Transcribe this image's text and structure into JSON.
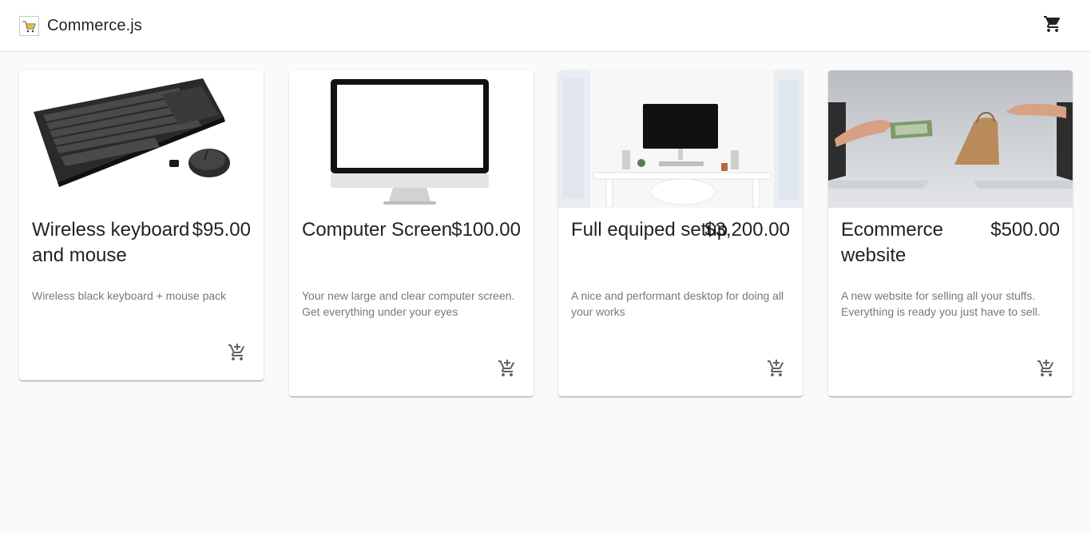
{
  "header": {
    "brand_title": "Commerce.js",
    "logo_icon": "store-logo-icon",
    "cart_icon": "shopping-cart-icon"
  },
  "products": [
    {
      "name": "Wireless keyboard and mouse",
      "price": "$95.00",
      "description": "Wireless black keyboard + mouse pack",
      "image_icon": "keyboard-mouse-image",
      "action_icon": "add-shopping-cart-icon"
    },
    {
      "name": "Computer Screen",
      "price": "$100.00",
      "description": "Your new large and clear computer screen. Get everything under your eyes",
      "image_icon": "monitor-image",
      "action_icon": "add-shopping-cart-icon"
    },
    {
      "name": "Full equiped setup",
      "price": "$3,200.00",
      "description": "A nice and performant desktop for doing all your works",
      "image_icon": "desk-setup-image",
      "action_icon": "add-shopping-cart-icon"
    },
    {
      "name": "Ecommerce website",
      "price": "$500.00",
      "description": "A new website for selling all your stuffs. Everything is ready you just have to sell.",
      "image_icon": "ecommerce-laptops-image",
      "action_icon": "add-shopping-cart-icon"
    }
  ],
  "colors": {
    "background": "#fafafa",
    "card": "#ffffff",
    "text_primary": "#212121",
    "text_secondary": "#757575",
    "icon": "#616161"
  }
}
